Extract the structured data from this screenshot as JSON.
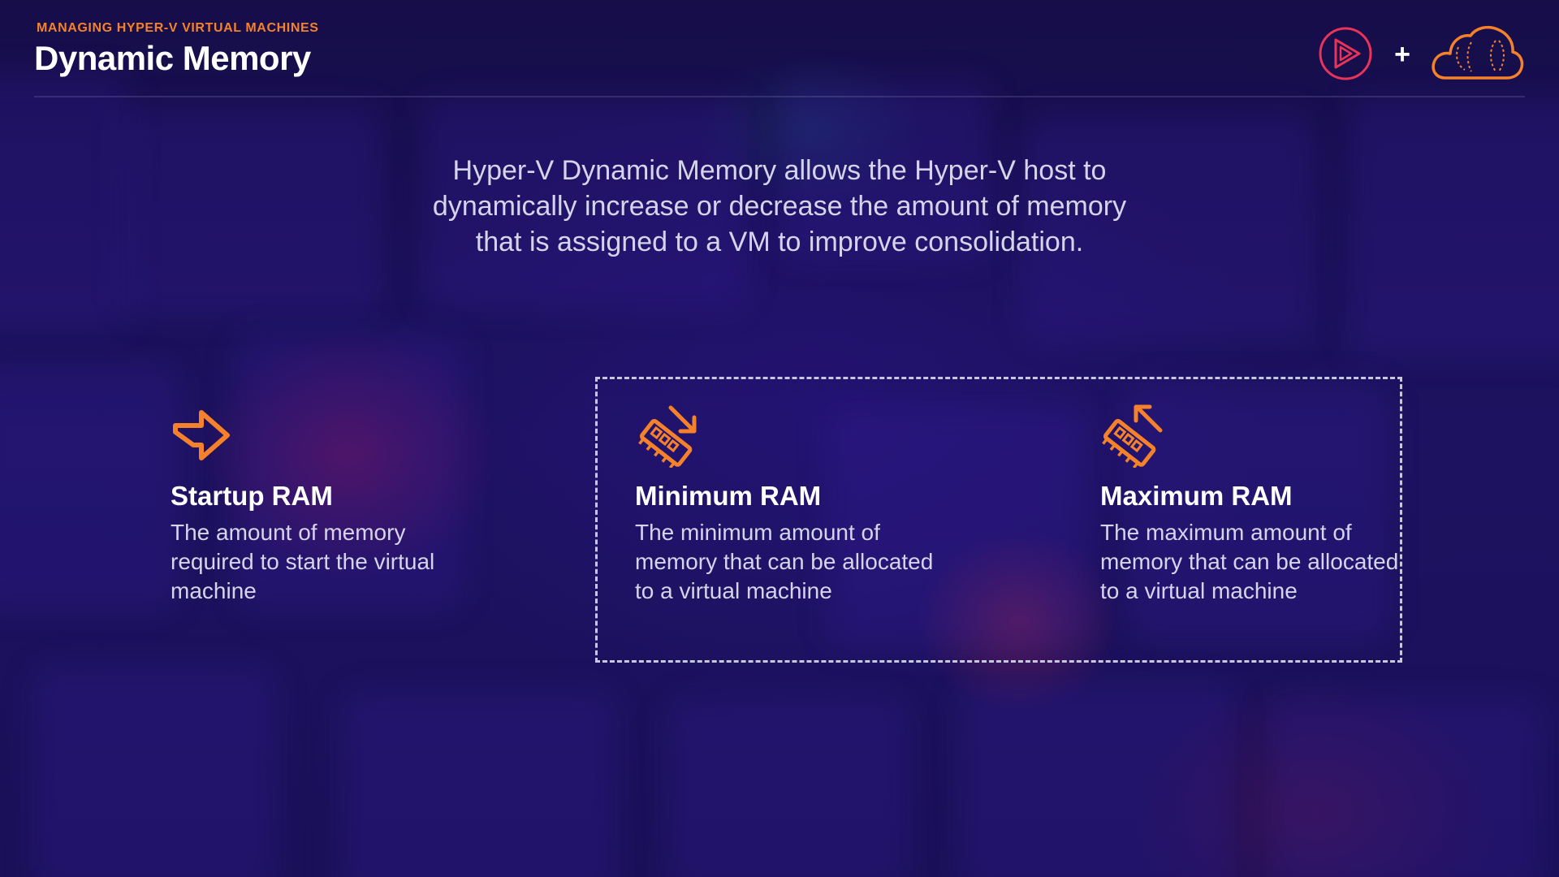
{
  "header": {
    "eyebrow": "MANAGING HYPER-V VIRTUAL MACHINES",
    "title": "Dynamic Memory",
    "plus": "+"
  },
  "intro": {
    "line1": "Hyper-V Dynamic Memory allows the Hyper-V host to",
    "line2": "dynamically increase or decrease the amount of memory",
    "line3": "that is assigned to a VM to improve consolidation."
  },
  "cards": [
    {
      "icon": "arrow-right-icon",
      "title": "Startup RAM",
      "description": "The amount of memory required to start the virtual machine"
    },
    {
      "icon": "memory-decrease-icon",
      "title": "Minimum RAM",
      "description": "The minimum amount of memory that can be allocated to a virtual machine"
    },
    {
      "icon": "memory-increase-icon",
      "title": "Maximum RAM",
      "description": "The maximum amount of memory that can be allocated to a virtual machine"
    }
  ],
  "colors": {
    "accent": "#f5822b",
    "ps_logo": "#e8335a",
    "background": "#1a0f52",
    "text": "#ffffff",
    "text_muted": "#d6d4ea"
  }
}
